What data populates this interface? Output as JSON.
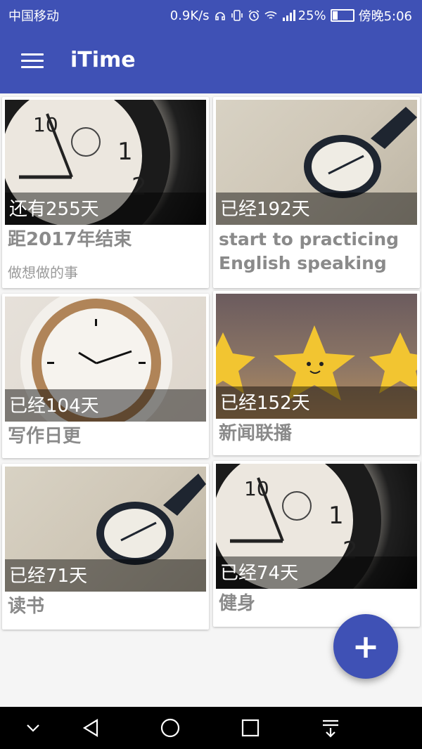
{
  "status": {
    "carrier": "中国移动",
    "speed": "0.9K/s",
    "battery_pct": "25%",
    "time": "傍晚5:06",
    "battery_level": 0.25
  },
  "appbar": {
    "title": "iTime"
  },
  "cards": [
    {
      "count": "还有255天",
      "title": "距2017年结束",
      "subtitle": "做想做的事",
      "image": "clock-closeup"
    },
    {
      "count": "已经192天",
      "title": "start to practicing English speaking",
      "subtitle": "",
      "image": "watch-desk"
    },
    {
      "count": "已经104天",
      "title": "写作日更",
      "subtitle": "",
      "image": "coffee"
    },
    {
      "count": "已经152天",
      "title": "新闻联播",
      "subtitle": "",
      "image": "stars"
    },
    {
      "count": "已经71天",
      "title": "读书",
      "subtitle": "",
      "image": "watch-desk"
    },
    {
      "count": "已经74天",
      "title": "健身",
      "subtitle": "",
      "image": "clock-closeup"
    }
  ],
  "fab": {
    "label": "+"
  },
  "navbar": {
    "icons": [
      "chevron-down-icon",
      "back-icon",
      "home-icon",
      "recents-icon",
      "notification-pull-icon"
    ]
  },
  "colors": {
    "primary": "#3f51b5",
    "card_bg": "#ffffff",
    "text_gray": "#8a8a8a"
  }
}
